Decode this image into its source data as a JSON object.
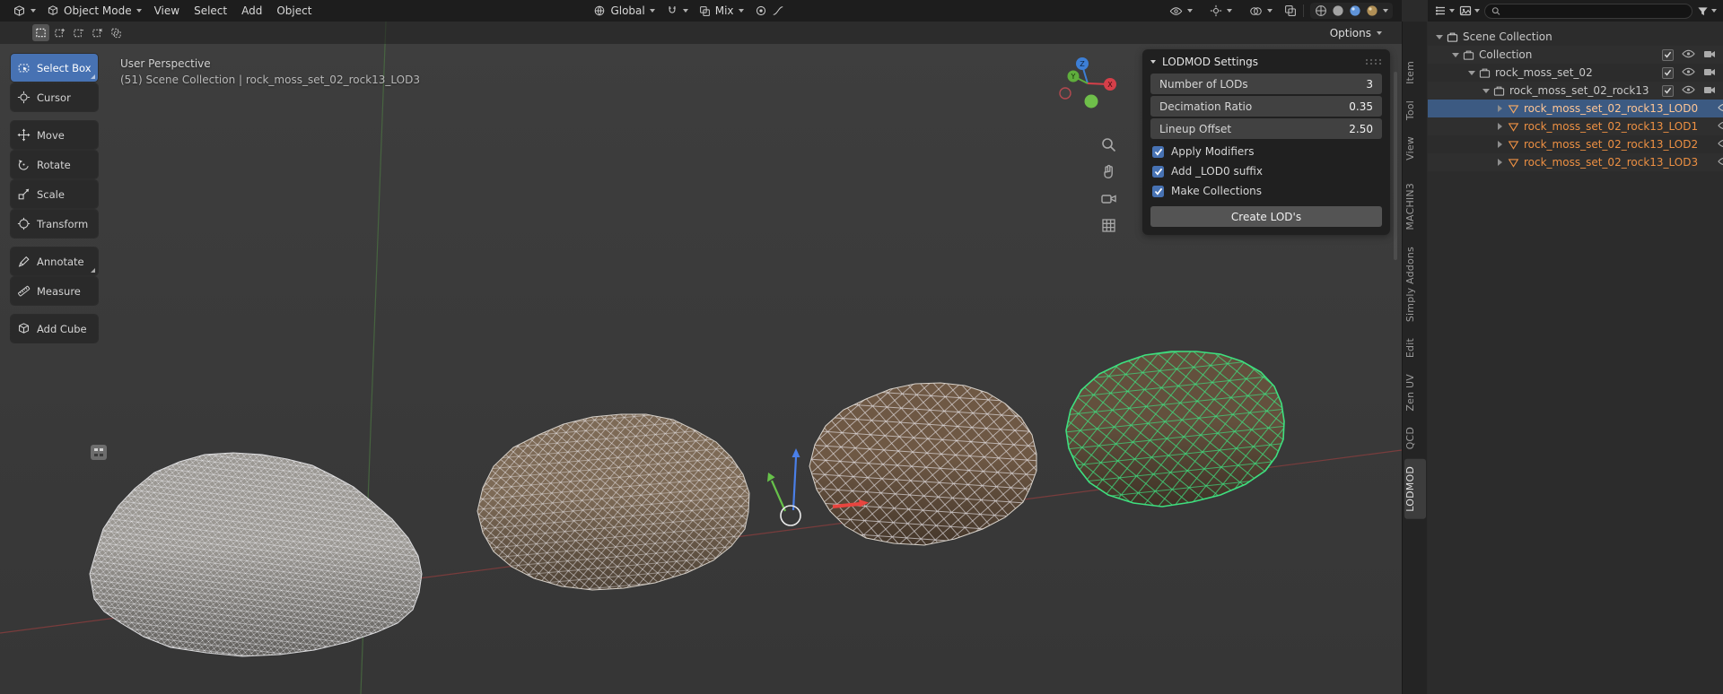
{
  "viewport_header": {
    "mode": "Object Mode",
    "menus": [
      "View",
      "Select",
      "Add",
      "Object"
    ],
    "orientation": "Global",
    "blend": "Mix"
  },
  "tool_header": {
    "options": "Options"
  },
  "toolbar": {
    "items": [
      {
        "label": "Select Box",
        "active": true
      },
      {
        "label": "Cursor"
      },
      {
        "label": "Move"
      },
      {
        "label": "Rotate"
      },
      {
        "label": "Scale"
      },
      {
        "label": "Transform"
      },
      {
        "label": "Annotate"
      },
      {
        "label": "Measure"
      },
      {
        "label": "Add Cube"
      }
    ]
  },
  "viewport": {
    "view_label": "User Perspective",
    "context_label": "(51) Scene Collection | rock_moss_set_02_rock13_LOD3",
    "gizmo": {
      "x": "X",
      "y": "Y",
      "z": "Z"
    }
  },
  "lod_panel": {
    "title": "LODMOD Settings",
    "fields": [
      {
        "label": "Number of LODs",
        "value": "3"
      },
      {
        "label": "Decimation Ratio",
        "value": "0.35"
      },
      {
        "label": "Lineup Offset",
        "value": "2.50"
      }
    ],
    "checkboxes": [
      {
        "label": "Apply Modifiers",
        "checked": true
      },
      {
        "label": "Add _LOD0 suffix",
        "checked": true
      },
      {
        "label": "Make Collections",
        "checked": true
      }
    ],
    "create_button": "Create LOD's"
  },
  "side_tabs": {
    "items": [
      "Item",
      "Tool",
      "View",
      "MACHIN3",
      "Simply Addons",
      "Edit",
      "Zen UV",
      "QCD",
      "LODMOD"
    ],
    "active": "LODMOD"
  },
  "outliner": {
    "search_placeholder": "",
    "rows": [
      {
        "label": "Scene Collection"
      },
      {
        "label": "Collection"
      },
      {
        "label": "rock_moss_set_02"
      },
      {
        "label": "rock_moss_set_02_rock13"
      },
      {
        "label": "rock_moss_set_02_rock13_LOD0",
        "selected": true
      },
      {
        "label": "rock_moss_set_02_rock13_LOD1"
      },
      {
        "label": "rock_moss_set_02_rock13_LOD2"
      },
      {
        "label": "rock_moss_set_02_rock13_LOD3"
      }
    ]
  },
  "colors": {
    "accent_blue": "#4772b3",
    "selected_row": "#3c5a82",
    "object_orange": "#ed9043",
    "active_object_orange": "#ffc695",
    "mesh_wire_green": "#3ee07f",
    "axis_x_red": "#e8453f",
    "axis_y_green": "#67c14a",
    "axis_z_blue": "#4a7fe8"
  }
}
